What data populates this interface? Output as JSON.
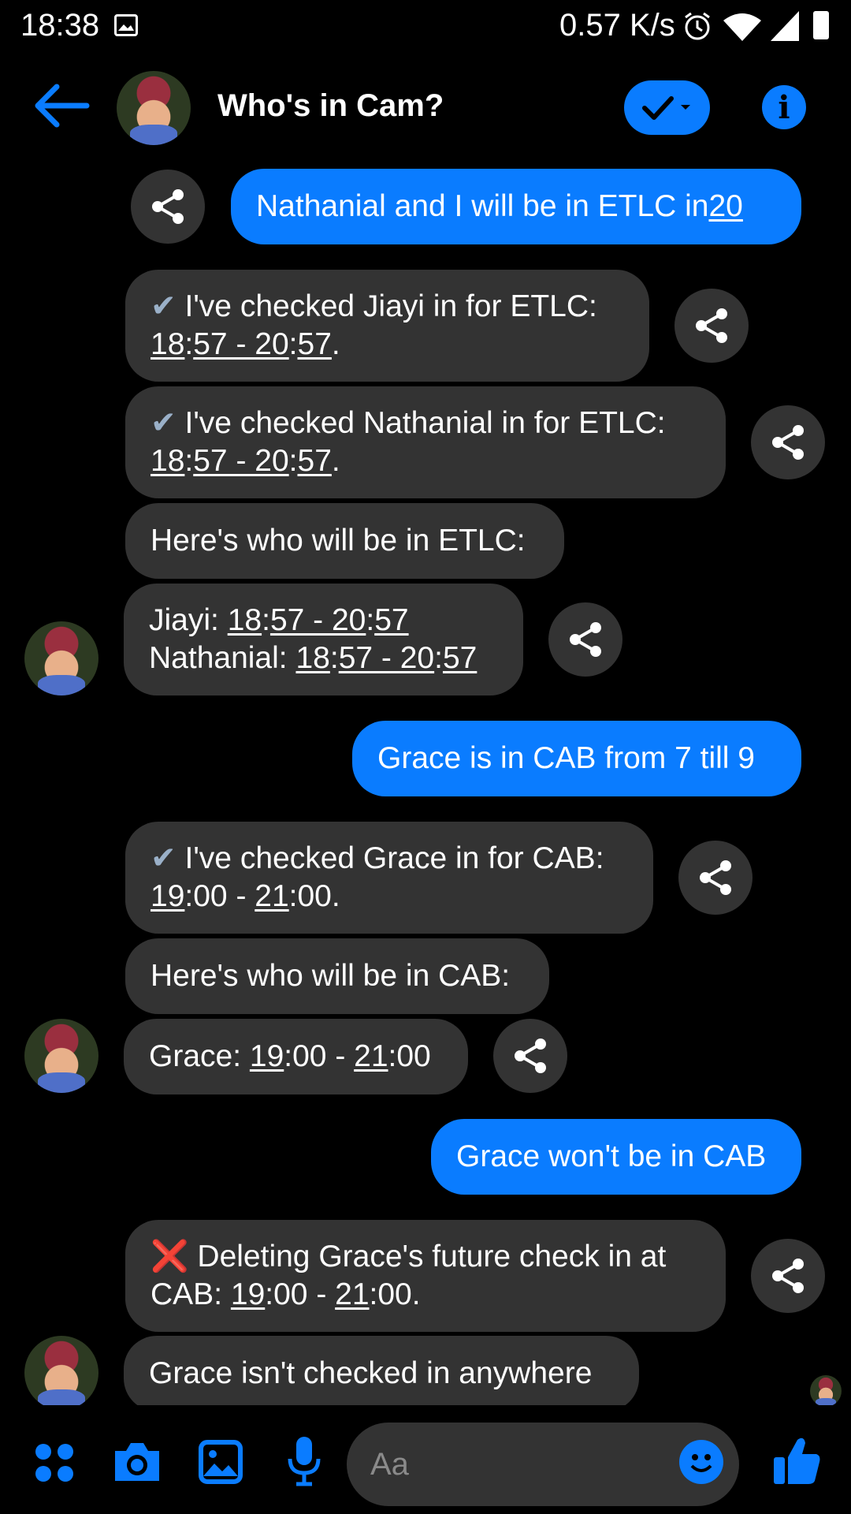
{
  "status_bar": {
    "time": "18:38",
    "speed": "0.57 K/s",
    "icons": [
      "image-icon",
      "alarm-icon",
      "wifi-icon",
      "signal-icon",
      "battery-icon"
    ]
  },
  "header": {
    "title": "Who's in Cam?",
    "accent": "#0a7cff"
  },
  "messages": {
    "m1": {
      "text_a": "Nathanial and I will be in ETLC in ",
      "text_b": "20"
    },
    "m2": {
      "check": "✔",
      "l1": " I've checked Jiayi in for ETLC:",
      "t1": "18",
      "t2": ":",
      "t3": "57 - 20",
      "t4": ":",
      "t5": "57",
      "end": "."
    },
    "m3": {
      "check": "✔",
      "l1": " I've checked Nathanial in for ETLC:",
      "t1": "18",
      "t2": ":",
      "t3": "57 - 20",
      "t4": ":",
      "t5": "57",
      "end": "."
    },
    "m4": {
      "text": "Here's who will be in ETLC:"
    },
    "m5": {
      "r1_label": "Jiayi: ",
      "r1_a": "18",
      "r1_b": ":",
      "r1_c": "57 - 20",
      "r1_d": ":",
      "r1_e": "57",
      "r2_label": "Nathanial: ",
      "r2_a": "18",
      "r2_b": ":",
      "r2_c": "57 - 20",
      "r2_d": ":",
      "r2_e": "57"
    },
    "m6": {
      "text": "Grace is in CAB from 7 till 9"
    },
    "m7": {
      "check": "✔",
      "l1": " I've checked Grace in for CAB:",
      "a": "19",
      "b": ":00 - ",
      "c": "21",
      "d": ":00."
    },
    "m8": {
      "text": "Here's who will be in CAB:"
    },
    "m9": {
      "label": "Grace: ",
      "a": "19",
      "b": ":00 - ",
      "c": "21",
      "d": ":00"
    },
    "m10": {
      "text": "Grace won't be in CAB"
    },
    "m11": {
      "x": "❌",
      "l1": " Deleting Grace's future check in at",
      "l2a": "CAB: ",
      "a": "19",
      "b": ":00 - ",
      "c": "21",
      "d": ":00."
    },
    "m12": {
      "text": "Grace isn't checked in anywhere"
    }
  },
  "composer": {
    "placeholder": "Aa",
    "icons": [
      "apps-icon",
      "camera-icon",
      "gallery-icon",
      "microphone-icon",
      "emoji-icon",
      "like-icon"
    ]
  }
}
